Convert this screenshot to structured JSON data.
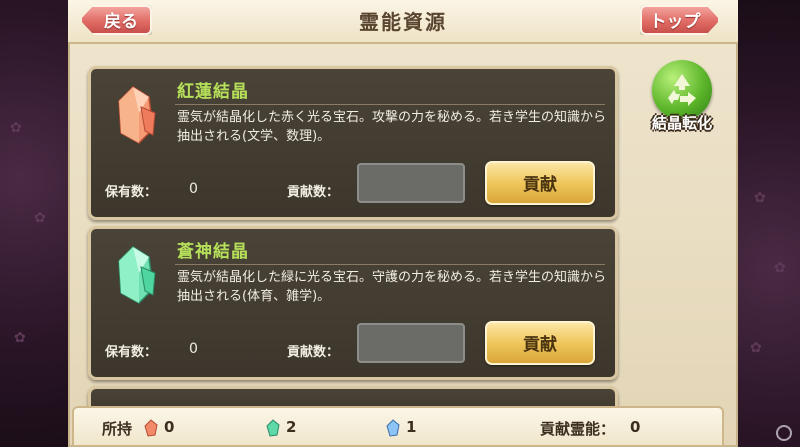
{
  "header": {
    "title": "霊能資源",
    "back_label": "戻る",
    "top_label": "トップ"
  },
  "cards": [
    {
      "name": "紅蓮結晶",
      "crystal_color": "#f07a5a",
      "description": "霊気が結晶化した赤く光る宝石。攻撃の力を秘める。若き学生の知識から抽出される(文学、数理)。",
      "owned_label": "保有数：",
      "owned_value": "0",
      "contribute_label": "貢献数：",
      "contribute_button": "貢献"
    },
    {
      "name": "蒼神結晶",
      "crystal_color": "#4fd6a0",
      "description": "霊気が結晶化した緑に光る宝石。守護の力を秘める。若き学生の知識から抽出される(体育、雑学)。",
      "owned_label": "保有数：",
      "owned_value": "0",
      "contribute_label": "貢献数：",
      "contribute_button": "貢献"
    }
  ],
  "convert_button": {
    "label": "結晶転化",
    "icon": "recycle-icon"
  },
  "footer": {
    "owned_label": "所持",
    "red_count": "0",
    "green_count": "2",
    "blue_count": "1",
    "contribution_label": "貢献霊能：",
    "contribution_value": "0"
  },
  "colors": {
    "accent_red": "#e06b65",
    "card_title_green": "#b6e05a",
    "contribute_gold": "#f0c65c"
  }
}
